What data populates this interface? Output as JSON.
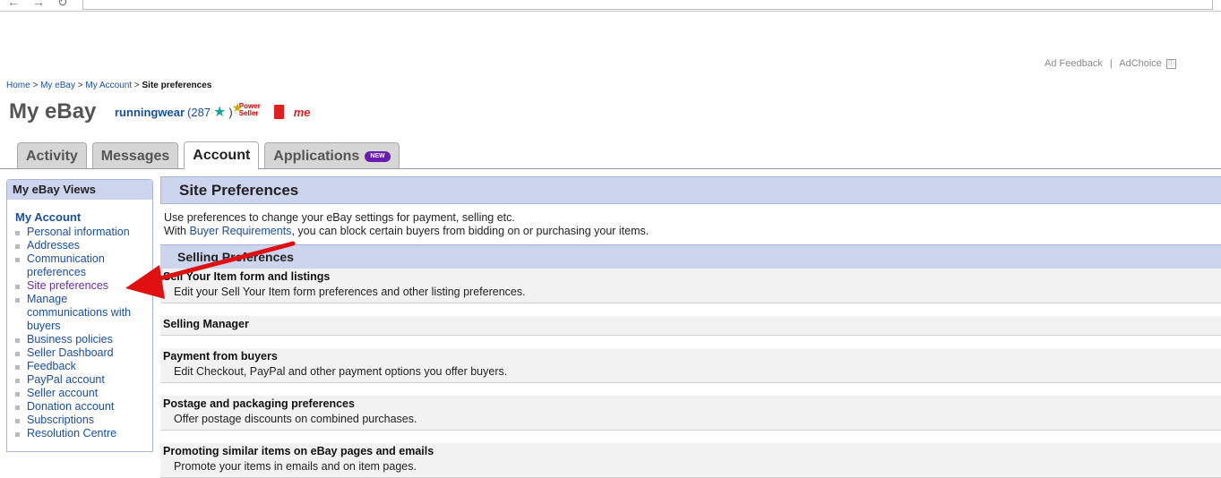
{
  "header": {
    "ad_feedback": "Ad Feedback",
    "separator": "|",
    "adchoice": "AdChoice"
  },
  "breadcrumb": {
    "home": "Home",
    "myebay": "My eBay",
    "account": "My Account",
    "current": "Site preferences",
    "sep": ">"
  },
  "page_title": "My eBay",
  "user": {
    "name": "runningwear",
    "feedback_open": "(287",
    "feedback_close": ")",
    "power_seller_line1": "Power",
    "power_seller_line2": "Seller",
    "me_badge": "me"
  },
  "tabs": [
    {
      "label": "Activity"
    },
    {
      "label": "Messages"
    },
    {
      "label": "Account"
    },
    {
      "label": "Applications",
      "badge": "NEW"
    }
  ],
  "sidebar": {
    "header": "My eBay Views",
    "section": "My Account",
    "items": [
      {
        "label": "Personal information"
      },
      {
        "label": "Addresses"
      },
      {
        "label": "Communication preferences"
      },
      {
        "label": "Site preferences"
      },
      {
        "label": "Manage communications with buyers"
      },
      {
        "label": "Business policies"
      },
      {
        "label": "Seller Dashboard"
      },
      {
        "label": "Feedback"
      },
      {
        "label": "PayPal account"
      },
      {
        "label": "Seller account"
      },
      {
        "label": "Donation account"
      },
      {
        "label": "Subscriptions"
      },
      {
        "label": "Resolution Centre"
      }
    ]
  },
  "main": {
    "title": "Site Preferences",
    "intro_line1": "Use preferences to change your eBay settings for payment, selling etc.",
    "intro_line2_pre": "With ",
    "intro_line2_link": "Buyer Requirements",
    "intro_line2_post": ", you can block certain buyers from bidding on or purchasing your items.",
    "section_title": "Selling Preferences",
    "rows": [
      {
        "title": "Sell Your Item form and listings",
        "desc": "Edit your Sell Your Item form preferences and other listing preferences."
      },
      {
        "title": "Selling Manager",
        "desc": ""
      },
      {
        "title": "Payment from buyers",
        "desc": "Edit Checkout, PayPal and other payment options you offer buyers."
      },
      {
        "title": "Postage and packaging preferences",
        "desc": "Offer postage discounts on combined purchases."
      },
      {
        "title": "Promoting similar items on eBay pages and emails",
        "desc": "Promote your items in emails and on item pages."
      }
    ]
  },
  "colors": {
    "link": "#1a4fa0",
    "header_bg": "#cdd5ee",
    "arrow": "#e01010",
    "new_badge": "#6a1bb0"
  }
}
